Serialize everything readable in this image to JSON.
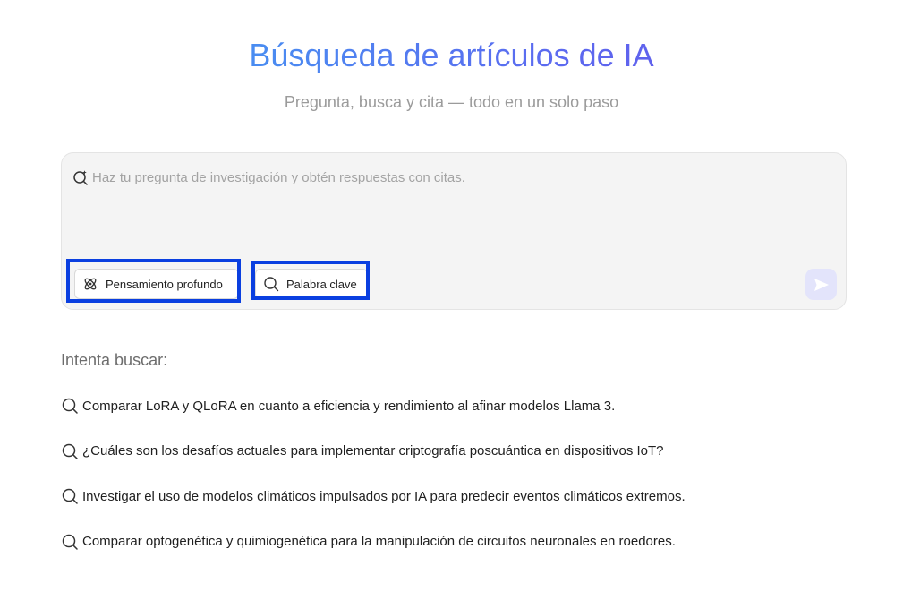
{
  "header": {
    "title": "Búsqueda de artículos de IA",
    "subtitle": "Pregunta, busca y cita — todo en un solo paso"
  },
  "search": {
    "placeholder": "Haz tu pregunta de investigación y obtén respuestas con citas.",
    "value": "",
    "modes": {
      "deep_thinking_label": "Pensamiento profundo",
      "keyword_label": "Palabra clave"
    },
    "send_icon": "send-icon"
  },
  "suggestions": {
    "heading": "Intenta buscar:",
    "items": [
      "Comparar LoRA y QLoRA en cuanto a eficiencia y rendimiento al afinar modelos Llama 3.",
      "¿Cuáles son los desafíos actuales para implementar criptografía poscuántica en dispositivos IoT?",
      "Investigar el uso de modelos climáticos impulsados por IA para predecir eventos climáticos extremos.",
      "Comparar optogenética y quimiogenética para la manipulación de circuitos neuronales en roedores."
    ]
  },
  "colors": {
    "title_gradient_start": "#3aaaf2",
    "title_gradient_end": "#6a4fe6",
    "highlight": "#0a3fe0",
    "send_button_bg": "#e3e4fb"
  }
}
